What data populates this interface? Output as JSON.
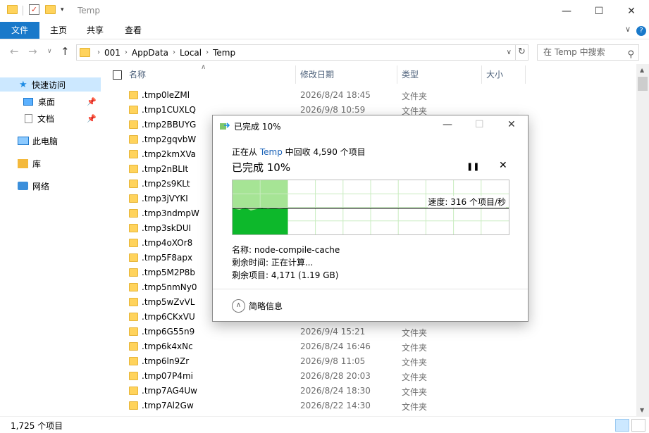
{
  "window": {
    "title": "Temp",
    "minimize_glyph": "—",
    "maximize_glyph": "☐",
    "close_glyph": "✕"
  },
  "ribbon": {
    "tabs": [
      "文件",
      "主页",
      "共享",
      "查看"
    ],
    "help_glyph": "?",
    "collapse_glyph": "∨"
  },
  "address": {
    "crumbs": [
      "001",
      "AppData",
      "Local",
      "Temp"
    ],
    "search_placeholder": "在 Temp 中搜索"
  },
  "sidebar": {
    "items": [
      {
        "label": "快速访问",
        "icon": "star-icon"
      },
      {
        "label": "桌面",
        "icon": "desktop-icon",
        "pinned": true
      },
      {
        "label": "文档",
        "icon": "documents-icon",
        "pinned": true
      },
      {
        "label": "此电脑",
        "icon": "computer-icon"
      },
      {
        "label": "库",
        "icon": "library-icon"
      },
      {
        "label": "网络",
        "icon": "network-icon"
      }
    ]
  },
  "columns": {
    "name": "名称",
    "date": "修改日期",
    "type": "类型",
    "size": "大小"
  },
  "files": [
    {
      "name": ".tmp0leZMl",
      "date": "2026/8/24 18:45",
      "type": "文件夹"
    },
    {
      "name": ".tmp1CUXLQ",
      "date": "2026/9/8 10:59",
      "type": "文件夹"
    },
    {
      "name": ".tmp2BBUYG",
      "date": "",
      "type": ""
    },
    {
      "name": ".tmp2gqvbW",
      "date": "",
      "type": ""
    },
    {
      "name": ".tmp2kmXVa",
      "date": "",
      "type": ""
    },
    {
      "name": ".tmp2nBLIt",
      "date": "",
      "type": ""
    },
    {
      "name": ".tmp2s9KLt",
      "date": "",
      "type": ""
    },
    {
      "name": ".tmp3jVYKI",
      "date": "",
      "type": ""
    },
    {
      "name": ".tmp3ndmpW",
      "date": "",
      "type": ""
    },
    {
      "name": ".tmp3skDUI",
      "date": "",
      "type": ""
    },
    {
      "name": ".tmp4oXOr8",
      "date": "",
      "type": ""
    },
    {
      "name": ".tmp5F8apx",
      "date": "",
      "type": ""
    },
    {
      "name": ".tmp5M2P8b",
      "date": "",
      "type": ""
    },
    {
      "name": ".tmp5nmNy0",
      "date": "",
      "type": ""
    },
    {
      "name": ".tmp5wZvVL",
      "date": "",
      "type": ""
    },
    {
      "name": ".tmp6CKxVU",
      "date": "",
      "type": ""
    },
    {
      "name": ".tmp6G55n9",
      "date": "2026/9/4 15:21",
      "type": "文件夹"
    },
    {
      "name": ".tmp6k4xNc",
      "date": "2026/8/24 16:46",
      "type": "文件夹"
    },
    {
      "name": ".tmp6ln9Zr",
      "date": "2026/9/8 11:05",
      "type": "文件夹"
    },
    {
      "name": ".tmp07P4mi",
      "date": "2026/8/28 20:03",
      "type": "文件夹"
    },
    {
      "name": ".tmp7AG4Uw",
      "date": "2026/8/24 18:30",
      "type": "文件夹"
    },
    {
      "name": ".tmp7Al2Gw",
      "date": "2026/8/22 14:30",
      "type": "文件夹"
    }
  ],
  "status": {
    "count": "1,725 个项目"
  },
  "dialog": {
    "title": "已完成 10%",
    "from_prefix": "正在从",
    "from_link": "Temp",
    "from_suffix": "中回收 4,590 个项目",
    "headline": "已完成 10%",
    "progress_fraction": 0.2,
    "pause_glyph": "❚❚",
    "cancel_glyph": "✕",
    "speed": "速度: 316 个项目/秒",
    "name_line": "名称: node-compile-cache",
    "time_line": "剩余时间: 正在计算...",
    "items_line": "剩余项目: 4,171 (1.19 GB)",
    "toggle_label": "简略信息",
    "toggle_glyph": "∧",
    "colors": {
      "progress_fill": "#a6e495",
      "speed_fill": "#0db82b",
      "grid": "#c9ecc0"
    }
  }
}
